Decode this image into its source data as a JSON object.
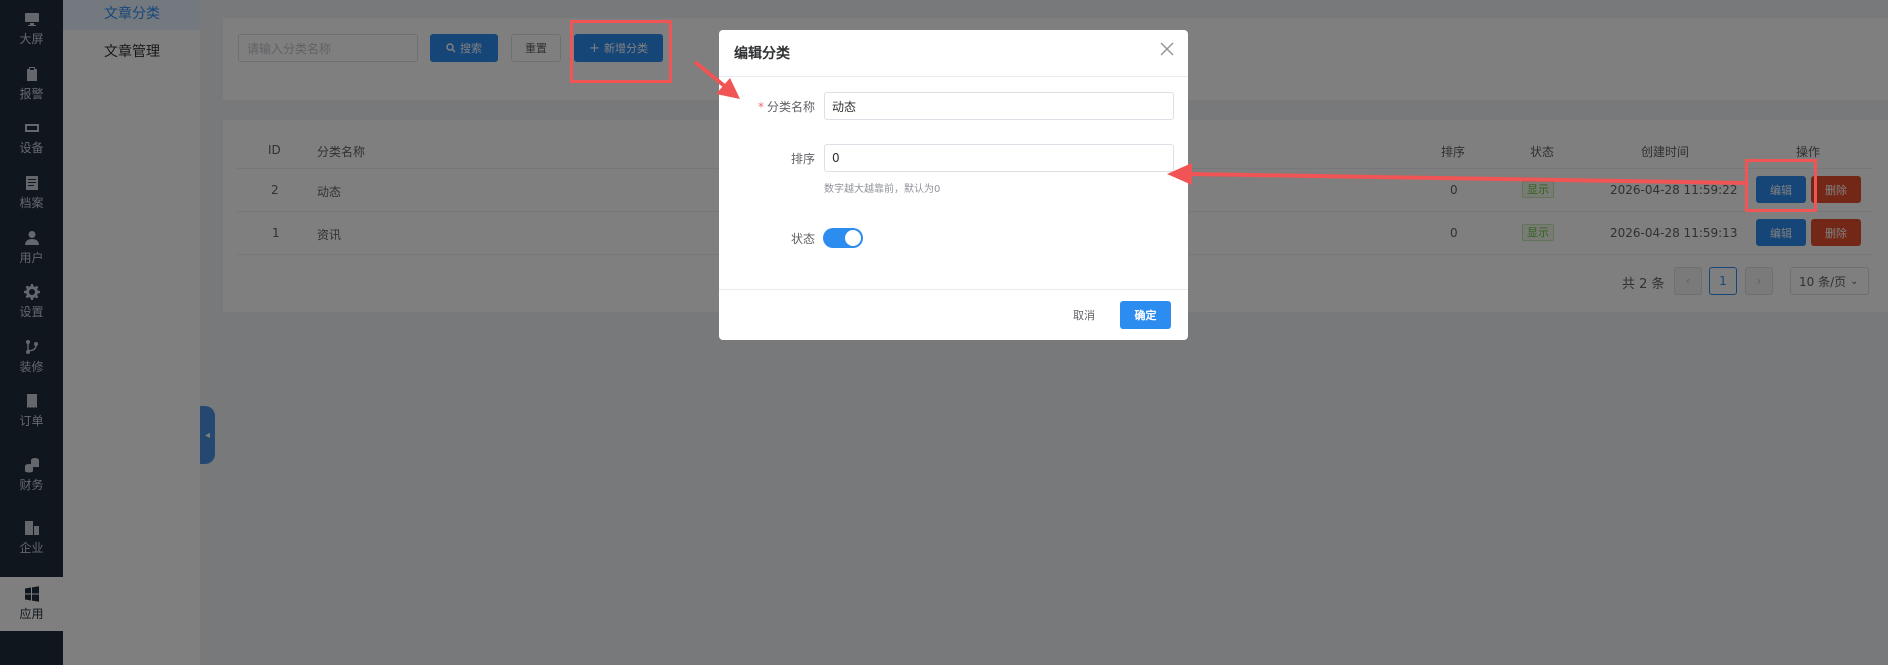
{
  "rail": [
    {
      "label": "大屏",
      "icon": "monitor-icon"
    },
    {
      "label": "报警",
      "icon": "clipboard-icon"
    },
    {
      "label": "设备",
      "icon": "device-icon"
    },
    {
      "label": "档案",
      "icon": "document-icon"
    },
    {
      "label": "用户",
      "icon": "user-icon"
    },
    {
      "label": "设置",
      "icon": "gear-icon"
    },
    {
      "label": "装修",
      "icon": "branch-icon"
    },
    {
      "label": "订单",
      "icon": "receipt-icon"
    },
    {
      "label": "财务",
      "icon": "coins-icon"
    },
    {
      "label": "企业",
      "icon": "building-icon"
    },
    {
      "label": "应用",
      "icon": "windows-icon"
    }
  ],
  "submenu": {
    "items": [
      "文章分类",
      "文章管理"
    ]
  },
  "search": {
    "placeholder": "请输入分类名称",
    "search_label": "搜索",
    "reset_label": "重置",
    "add_label": "新增分类"
  },
  "table": {
    "headers": {
      "id": "ID",
      "name": "分类名称",
      "sort": "排序",
      "status": "状态",
      "created": "创建时间",
      "actions": "操作"
    },
    "rows": [
      {
        "id": "2",
        "name": "动态",
        "sort": "0",
        "status": "显示",
        "created": "2026-04-28 11:59:22",
        "edit": "编辑",
        "delete": "删除"
      },
      {
        "id": "1",
        "name": "资讯",
        "sort": "0",
        "status": "显示",
        "created": "2026-04-28 11:59:13",
        "edit": "编辑",
        "delete": "删除"
      }
    ]
  },
  "pager": {
    "total": "共 2 条",
    "current": "1",
    "size": "10 条/页"
  },
  "dialog": {
    "title": "编辑分类",
    "name_label": "分类名称",
    "name_value": "动态",
    "sort_label": "排序",
    "sort_value": "0",
    "sort_hint": "数字越大越靠前，默认为0",
    "status_label": "状态",
    "status_on": true,
    "cancel_label": "取消",
    "ok_label": "确定"
  },
  "colors": {
    "primary": "#2d8cf0",
    "danger": "#e6502f",
    "annotation": "#f05454",
    "rail": "#1f2d3d"
  }
}
